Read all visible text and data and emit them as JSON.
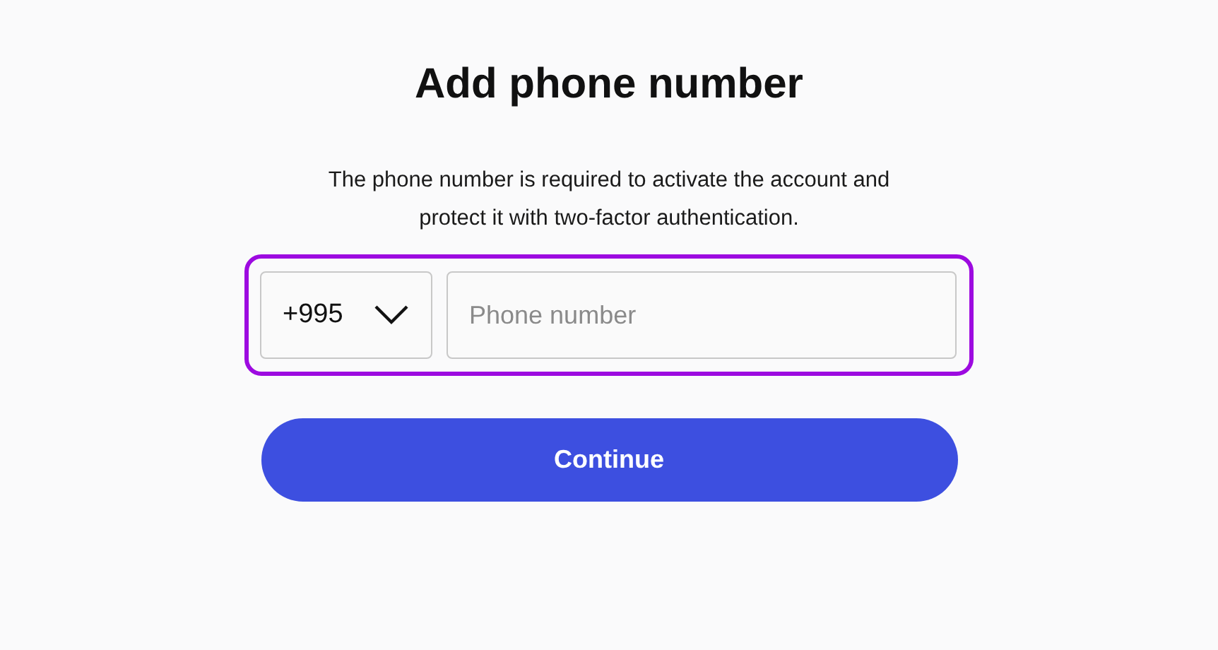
{
  "title": "Add phone number",
  "description": "The phone number is required to activate the account and protect it with two-factor authentication.",
  "phone_form": {
    "highlighted": true,
    "country_code": {
      "value": "+995"
    },
    "phone": {
      "placeholder": "Phone number"
    }
  },
  "continue_button": {
    "label": "Continue"
  }
}
